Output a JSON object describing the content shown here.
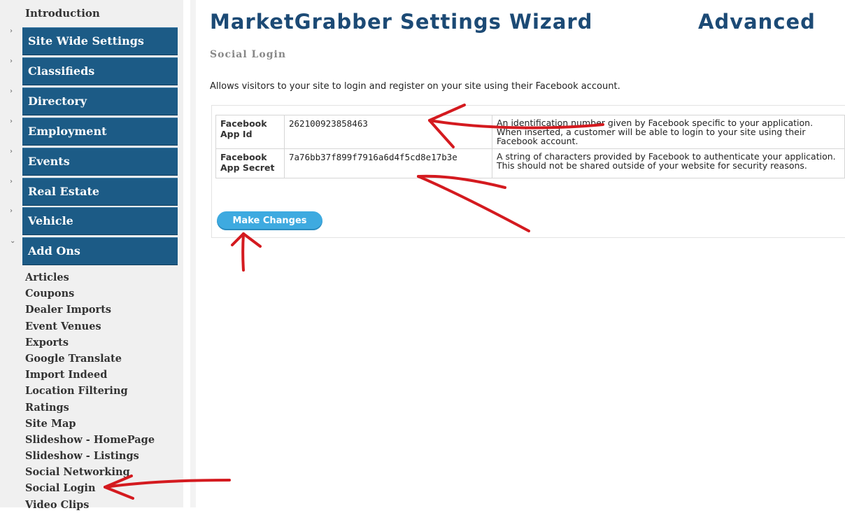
{
  "sidebar": {
    "intro": "Introduction",
    "sections": [
      {
        "label": "Site Wide Settings",
        "arrow": "›"
      },
      {
        "label": "Classifieds",
        "arrow": "›"
      },
      {
        "label": "Directory",
        "arrow": "›"
      },
      {
        "label": "Employment",
        "arrow": "›"
      },
      {
        "label": "Events",
        "arrow": "›"
      },
      {
        "label": "Real Estate",
        "arrow": "›"
      },
      {
        "label": "Vehicle",
        "arrow": "›"
      },
      {
        "label": "Add Ons",
        "arrow": "⌄"
      }
    ],
    "addons": [
      "Articles",
      "Coupons",
      "Dealer Imports",
      "Event Venues",
      "Exports",
      "Google Translate",
      "Import Indeed",
      "Location Filtering",
      "Ratings",
      "Site Map",
      "Slideshow - HomePage",
      "Slideshow - Listings",
      "Social Networking",
      "Social Login",
      "Video Clips"
    ]
  },
  "main": {
    "title": "MarketGrabber Settings Wizard",
    "title_right": "Advanced",
    "subtitle": "Social Login",
    "description": "Allows visitors to your site to login and register on your site using their Facebook account.",
    "rows": [
      {
        "label": "Facebook App Id",
        "value": "262100923858463",
        "help": "An identification number given by Facebook specific to your application. When inserted, a customer will be able to login to your site using their Facebook account."
      },
      {
        "label": "Facebook App Secret",
        "value": "7a76bb37f899f7916a6d4f5cd8e17b3e",
        "help": "A string of characters provided by Facebook to authenticate your application. This should not be shared outside of your website for security reasons."
      }
    ],
    "button": "Make Changes"
  },
  "colors": {
    "nav_bg": "#1c5b86",
    "title": "#1c4a75",
    "button": "#3eaae0",
    "annotation": "#d41a1f"
  }
}
